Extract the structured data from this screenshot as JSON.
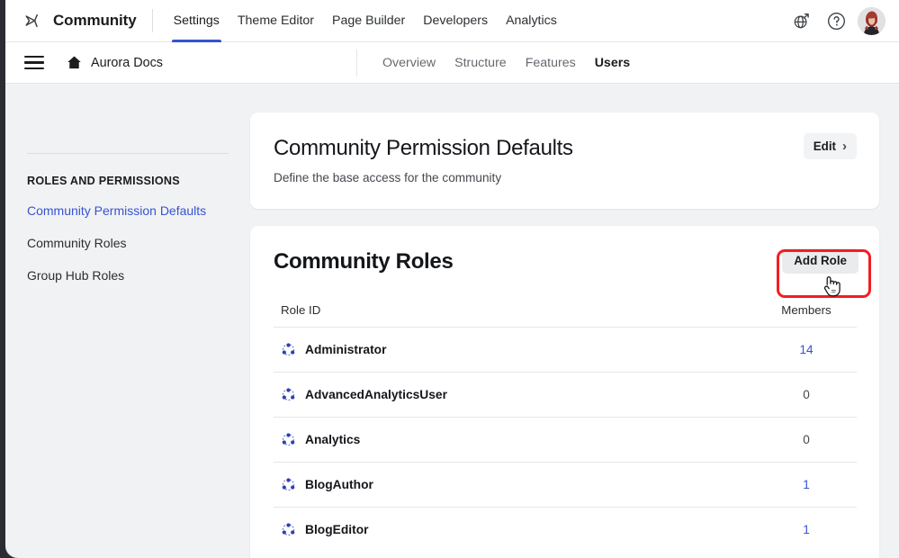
{
  "topbar": {
    "logo_icon": "khoros-logo-icon",
    "brand": "Community",
    "nav": [
      {
        "label": "Settings",
        "active": true
      },
      {
        "label": "Theme Editor",
        "active": false
      },
      {
        "label": "Page Builder",
        "active": false
      },
      {
        "label": "Developers",
        "active": false
      },
      {
        "label": "Analytics",
        "active": false
      }
    ],
    "actions": [
      {
        "icon": "globe-external-link-icon",
        "name": "visit-community-button"
      },
      {
        "icon": "help-circle-icon",
        "name": "help-button"
      }
    ],
    "avatar_name": "user-avatar"
  },
  "subbar": {
    "menu_icon": "hamburger-menu-icon",
    "home_icon": "home-icon",
    "context_title": "Aurora Docs",
    "tabs": [
      {
        "label": "Overview",
        "active": false
      },
      {
        "label": "Structure",
        "active": false
      },
      {
        "label": "Features",
        "active": false
      },
      {
        "label": "Users",
        "active": true
      }
    ]
  },
  "sidebar": {
    "heading": "ROLES AND PERMISSIONS",
    "items": [
      {
        "label": "Community Permission Defaults",
        "active": true
      },
      {
        "label": "Community Roles",
        "active": false
      },
      {
        "label": "Group Hub Roles",
        "active": false
      }
    ]
  },
  "permission_card": {
    "title": "Community Permission Defaults",
    "subtitle": "Define the base access for the community",
    "edit_label": "Edit",
    "chevron": "›"
  },
  "roles_card": {
    "title": "Community Roles",
    "add_role_label": "Add Role",
    "columns": {
      "role_id": "Role ID",
      "members": "Members"
    },
    "rows": [
      {
        "icon": "role-group-icon",
        "name": "Administrator",
        "members": "14",
        "members_is_link": true
      },
      {
        "icon": "role-group-icon",
        "name": "AdvancedAnalyticsUser",
        "members": "0",
        "members_is_link": false
      },
      {
        "icon": "role-group-icon",
        "name": "Analytics",
        "members": "0",
        "members_is_link": false
      },
      {
        "icon": "role-group-icon",
        "name": "BlogAuthor",
        "members": "1",
        "members_is_link": true
      },
      {
        "icon": "role-group-icon",
        "name": "BlogEditor",
        "members": "1",
        "members_is_link": true
      }
    ]
  },
  "annotation": {
    "highlight_color": "#f51d20",
    "highlight_target": "add-role-button",
    "cursor_icon": "pointing-hand-cursor"
  },
  "colors": {
    "accent": "#3653d4",
    "page_bg": "#f1f2f3",
    "card_bg": "#ffffff",
    "text_primary": "#14161a",
    "text_secondary": "#45484d",
    "border": "#e4e6e8"
  }
}
